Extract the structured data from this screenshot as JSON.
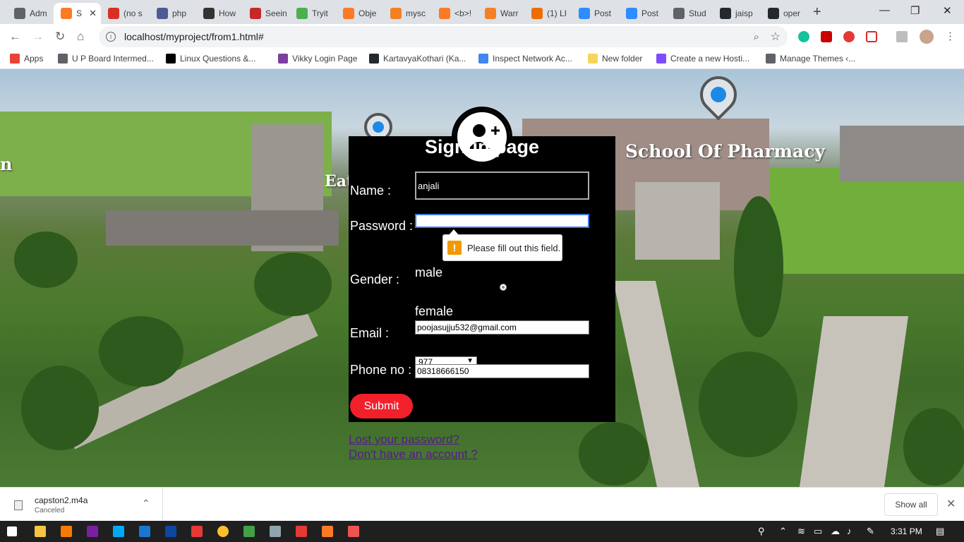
{
  "browser": {
    "tabs": [
      {
        "label": "Adm",
        "icon": "globe-icon",
        "color": "#5f6368",
        "active": false
      },
      {
        "label": "S",
        "icon": "xampp-icon",
        "color": "#fb7a24",
        "active": true
      },
      {
        "label": "(no s",
        "icon": "gmail-icon",
        "color": "#d93025",
        "active": false
      },
      {
        "label": "php",
        "icon": "php-icon",
        "color": "#4f5b93",
        "active": false
      },
      {
        "label": "How",
        "icon": "wiki-icon",
        "color": "#333333",
        "active": false
      },
      {
        "label": "Seein",
        "icon": "pulse-icon",
        "color": "#c62828",
        "active": false
      },
      {
        "label": "Tryit",
        "icon": "w3-icon",
        "color": "#4caf50",
        "active": false
      },
      {
        "label": "Obje",
        "icon": "xampp-icon",
        "color": "#fb7a24",
        "active": false
      },
      {
        "label": "mysc",
        "icon": "stackoverflow-icon",
        "color": "#f48024",
        "active": false
      },
      {
        "label": "<b>!",
        "icon": "xampp-icon",
        "color": "#fb7a24",
        "active": false
      },
      {
        "label": "Warr",
        "icon": "stackoverflow-icon",
        "color": "#f48024",
        "active": false
      },
      {
        "label": "(1) LI",
        "icon": "orange-ball-icon",
        "color": "#ef6c00",
        "active": false
      },
      {
        "label": "Post",
        "icon": "zoom-icon",
        "color": "#2d8cff",
        "active": false
      },
      {
        "label": "Post",
        "icon": "zoom-icon",
        "color": "#2d8cff",
        "active": false
      },
      {
        "label": "Stud",
        "icon": "globe-icon",
        "color": "#5f6368",
        "active": false
      },
      {
        "label": "jaisp",
        "icon": "github-icon",
        "color": "#24292e",
        "active": false
      },
      {
        "label": "oper",
        "icon": "github-icon",
        "color": "#24292e",
        "active": false
      }
    ],
    "url": "localhost/myproject/from1.html#",
    "bookmarks": [
      {
        "label": "Apps",
        "color": "#ea4335"
      },
      {
        "label": "U P Board Intermed...",
        "color": "#5f6368"
      },
      {
        "label": "Linux Questions &...",
        "color": "#000000"
      },
      {
        "label": "Vikky Login Page",
        "color": "#7b3fa0"
      },
      {
        "label": "KartavyaKothari (Ka...",
        "color": "#24292e"
      },
      {
        "label": "Inspect Network Ac...",
        "color": "#4285f4"
      },
      {
        "label": "New folder",
        "color": "#f6d55c"
      },
      {
        "label": "Create a new Hosti...",
        "color": "#7c4dff"
      },
      {
        "label": "Manage Themes ‹...",
        "color": "#5f6368"
      }
    ]
  },
  "background": {
    "caption_left": "n",
    "caption_mid": "Eat",
    "caption_right": "School Of  Pharmacy"
  },
  "form": {
    "title": "Signup page",
    "name_label": "Name :",
    "name_value": "anjali",
    "password_label": "Password :",
    "password_value": "",
    "gender_label": "Gender :",
    "gender_male": "male",
    "gender_female": "female",
    "email_label": "Email :",
    "email_value": "poojasujju532@gmail.com",
    "phone_label": "Phone no :",
    "country_code": "977",
    "phone_value": "08318666150",
    "submit_label": "Submit",
    "validation_message": "Please fill out this field."
  },
  "links": {
    "lost_password": "Lost your password?",
    "no_account": "Don't have an account ?"
  },
  "downloads": {
    "filename": "capston2.m4a",
    "status": "Canceled",
    "show_all": "Show all"
  },
  "taskbar": {
    "time": "3:31 PM"
  }
}
